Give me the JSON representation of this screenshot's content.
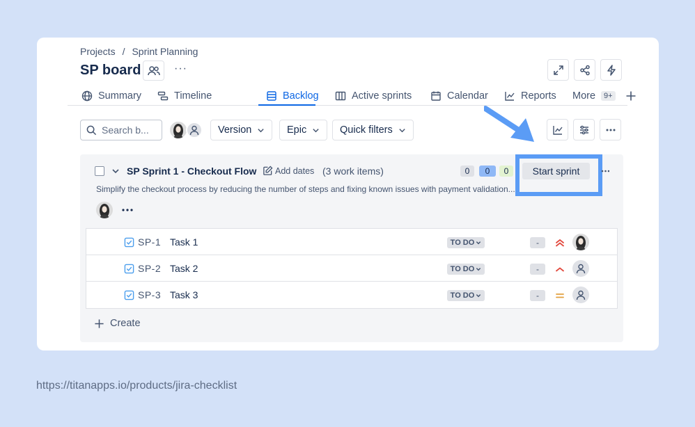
{
  "breadcrumb": {
    "projects": "Projects",
    "separator": "/",
    "current": "Sprint Planning"
  },
  "board": {
    "title": "SP board",
    "more": "···"
  },
  "tabs": [
    {
      "label": "Summary",
      "icon": "globe-icon"
    },
    {
      "label": "Timeline",
      "icon": "timeline-icon"
    },
    {
      "label": "Backlog",
      "icon": "backlog-icon",
      "active": true
    },
    {
      "label": "Active sprints",
      "icon": "columns-icon"
    },
    {
      "label": "Calendar",
      "icon": "calendar-icon"
    },
    {
      "label": "Reports",
      "icon": "reports-icon"
    },
    {
      "label": "More",
      "badge": "9+"
    }
  ],
  "toolbar": {
    "search_placeholder": "Search b...",
    "version": "Version",
    "epic": "Epic",
    "quick_filters": "Quick filters"
  },
  "sprint": {
    "name": "SP Sprint 1 - Checkout Flow",
    "add_dates": "Add dates",
    "count": "(3 work items)",
    "todo_count": "0",
    "inprogress_count": "0",
    "done_count": "0",
    "start_label": "Start sprint",
    "description": "Simplify the checkout process by reducing the number of steps and fixing known issues with payment validation..."
  },
  "issues": [
    {
      "key": "SP-1",
      "summary": "Task 1",
      "status": "TO DO",
      "estimate": "-",
      "priority": "highest",
      "assignee": "photo"
    },
    {
      "key": "SP-2",
      "summary": "Task 2",
      "status": "TO DO",
      "estimate": "-",
      "priority": "high",
      "assignee": "unassigned"
    },
    {
      "key": "SP-3",
      "summary": "Task 3",
      "status": "TO DO",
      "estimate": "-",
      "priority": "medium",
      "assignee": "unassigned"
    }
  ],
  "create_label": "Create",
  "footer_url": "https://titanapps.io/products/jira-checklist",
  "colors": {
    "background": "#d3e1f8",
    "accent": "#0c66e4",
    "highlight": "#5b9cf5",
    "priority_high": "#e2483d",
    "priority_medium": "#e2a03f"
  }
}
